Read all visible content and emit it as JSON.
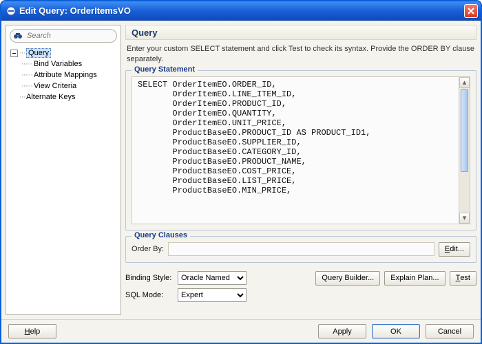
{
  "window": {
    "title": "Edit Query: OrderItemsVO"
  },
  "sidebar": {
    "search_placeholder": "Search",
    "nodes": {
      "query": "Query",
      "bind_variables": "Bind Variables",
      "attribute_mappings": "Attribute Mappings",
      "view_criteria": "View Criteria",
      "alternate_keys": "Alternate Keys"
    }
  },
  "main": {
    "header": "Query",
    "description": "Enter your custom SELECT statement and click Test to check its syntax.  Provide the ORDER BY clause separately.",
    "statement_legend": "Query Statement",
    "sql": "SELECT OrderItemEO.ORDER_ID, \n       OrderItemEO.LINE_ITEM_ID, \n       OrderItemEO.PRODUCT_ID, \n       OrderItemEO.QUANTITY, \n       OrderItemEO.UNIT_PRICE, \n       ProductBaseEO.PRODUCT_ID AS PRODUCT_ID1, \n       ProductBaseEO.SUPPLIER_ID, \n       ProductBaseEO.CATEGORY_ID, \n       ProductBaseEO.PRODUCT_NAME, \n       ProductBaseEO.COST_PRICE, \n       ProductBaseEO.LIST_PRICE, \n       ProductBaseEO.MIN_PRICE, ",
    "clauses_legend": "Query Clauses",
    "order_by_label": "Order By:",
    "order_by_value": "",
    "edit_label": "Edit...",
    "binding_style_label": "Binding Style:",
    "binding_style_value": "Oracle Named",
    "sql_mode_label": "SQL Mode:",
    "sql_mode_value": "Expert",
    "query_builder_label": "Query Builder...",
    "explain_plan_label": "Explain Plan...",
    "test_label": "Test"
  },
  "footer": {
    "help": "Help",
    "apply": "Apply",
    "ok": "OK",
    "cancel": "Cancel"
  }
}
